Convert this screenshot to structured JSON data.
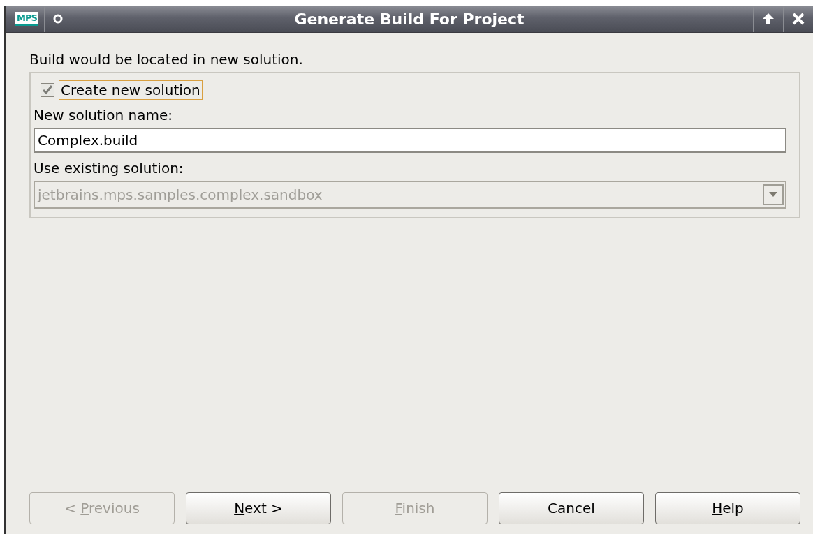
{
  "window": {
    "app_logo": "MPS",
    "title": "Generate Build For Project"
  },
  "intro": "Build would be located in new solution.",
  "create_new": {
    "label": "Create new solution",
    "checked": true,
    "focused": true
  },
  "name_label": "New solution name:",
  "name_field": {
    "value": "Complex.build"
  },
  "existing_label": "Use existing solution:",
  "existing_combo": {
    "value": "jetbrains.mps.samples.complex.sandbox",
    "disabled": true
  },
  "buttons": [
    {
      "text_before": "< ",
      "mnemonic": "P",
      "text_after": "revious",
      "disabled": true
    },
    {
      "mnemonic": "N",
      "text_after": "ext >",
      "disabled": false
    },
    {
      "mnemonic": "F",
      "text_after": "inish",
      "disabled": true
    },
    {
      "text_before": "Cancel",
      "disabled": false
    },
    {
      "mnemonic": "H",
      "text_after": "elp",
      "disabled": false
    }
  ]
}
